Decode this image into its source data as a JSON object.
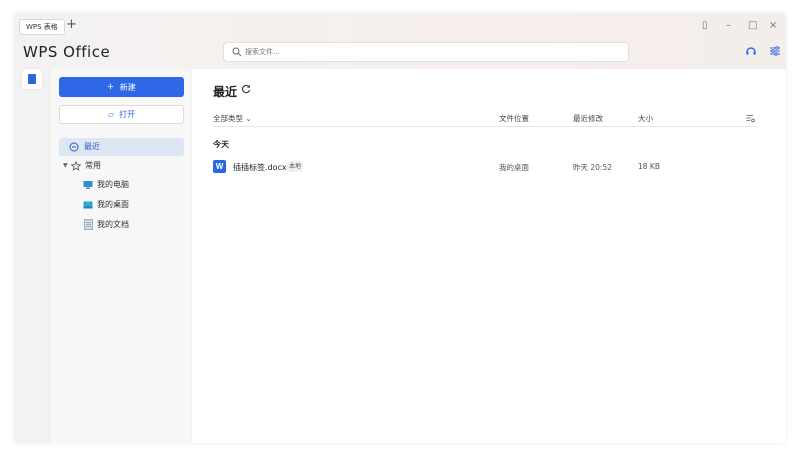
{
  "titlebar": {
    "tab_label": "WPS 表格",
    "add_tab": "+",
    "controls": {
      "tablet": "▯",
      "minimize": "–",
      "maximize": "□",
      "close": "×"
    }
  },
  "header": {
    "logo": "WPS Office",
    "search_placeholder": "搜索文件..."
  },
  "sidebar": {
    "new_label": "新建",
    "open_label": "打开",
    "recent_label": "最近",
    "common_label": "常用",
    "items": [
      {
        "label": "我的电脑",
        "icon": "computer-icon"
      },
      {
        "label": "我的桌面",
        "icon": "desktop-icon"
      },
      {
        "label": "我的文档",
        "icon": "documents-icon"
      }
    ]
  },
  "main": {
    "title": "最近",
    "columns": {
      "type_filter": "全部类型 ⌄",
      "location": "文件位置",
      "modified": "最近修改",
      "size": "大小"
    },
    "group_label": "今天",
    "files": [
      {
        "icon_letter": "W",
        "name": "插插标签.docx",
        "badge": "本地",
        "location": "我的桌面",
        "modified": "昨天 20:52",
        "size": "18 KB"
      }
    ]
  },
  "colors": {
    "accent": "#2f67e6",
    "selected_bg": "#dde6f3",
    "word_icon": "#2b65e0"
  }
}
